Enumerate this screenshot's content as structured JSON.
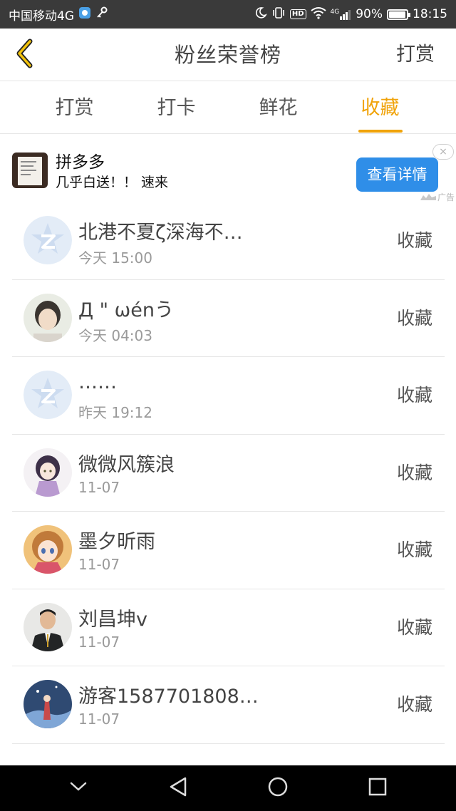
{
  "status_bar": {
    "carrier": "中国移动4G",
    "signal_label": "4G",
    "hd_label": "HD",
    "battery_percent": "90%",
    "battery_level": 0.9,
    "time": "18:15",
    "icons": [
      "carrier-app-icon",
      "key-icon",
      "moon-icon",
      "vibrate-icon",
      "hd-icon",
      "wifi-icon",
      "signal-icon",
      "battery-icon"
    ]
  },
  "header": {
    "back_icon": "chevron-left-icon",
    "title": "粉丝荣誉榜",
    "action_label": "打赏"
  },
  "tabs": [
    {
      "label": "打赏",
      "active": false
    },
    {
      "label": "打卡",
      "active": false
    },
    {
      "label": "鲜花",
      "active": false
    },
    {
      "label": "收藏",
      "active": true
    }
  ],
  "ad": {
    "title": "拼多多",
    "description": "几乎白送！！ 速来",
    "cta_label": "查看详情",
    "close_symbol": "×",
    "badge_label": "广告"
  },
  "fans": [
    {
      "name": "北港不夏ζ深海不…",
      "time": "今天 15:00",
      "action": "收藏",
      "avatar": "default-avatar"
    },
    {
      "name": "Д \" ωénう",
      "time": "今天 04:03",
      "action": "收藏",
      "avatar": "photo-avatar"
    },
    {
      "name": "……",
      "time": "昨天 19:12",
      "action": "收藏",
      "avatar": "default-avatar"
    },
    {
      "name": "微微风簇浪",
      "time": "11-07",
      "action": "收藏",
      "avatar": "anime-girl-avatar"
    },
    {
      "name": "墨夕昕雨",
      "time": "11-07",
      "action": "收藏",
      "avatar": "anime-girl-avatar"
    },
    {
      "name": "刘昌坤v",
      "time": "11-07",
      "action": "收藏",
      "avatar": "man-photo-avatar"
    },
    {
      "name": "游客1587701808…",
      "time": "11-07",
      "action": "收藏",
      "avatar": "scenery-avatar"
    }
  ],
  "colors": {
    "accent": "#f0a30a",
    "cta_blue": "#2f8ee8",
    "status_bar": "#3a3a3a",
    "nav_bar": "#000000"
  }
}
